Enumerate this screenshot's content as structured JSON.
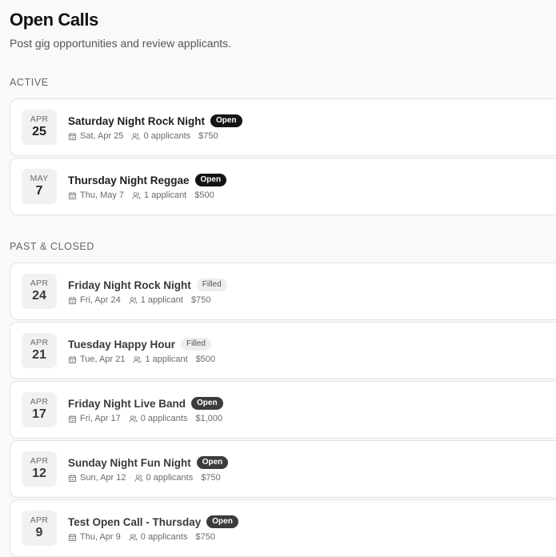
{
  "header": {
    "title": "Open Calls",
    "subtitle": "Post gig opportunities and review applicants."
  },
  "sections": {
    "active": {
      "heading": "ACTIVE",
      "items": [
        {
          "month": "APR",
          "day": "25",
          "title": "Saturday Night Rock Night",
          "status": "Open",
          "date": "Sat, Apr 25",
          "applicants": "0 applicants",
          "pay": "$750"
        },
        {
          "month": "MAY",
          "day": "7",
          "title": "Thursday Night Reggae",
          "status": "Open",
          "date": "Thu, May 7",
          "applicants": "1 applicant",
          "pay": "$500"
        }
      ]
    },
    "past": {
      "heading": "PAST & CLOSED",
      "items": [
        {
          "month": "APR",
          "day": "24",
          "title": "Friday Night Rock Night",
          "status": "Filled",
          "date": "Fri, Apr 24",
          "applicants": "1 applicant",
          "pay": "$750"
        },
        {
          "month": "APR",
          "day": "21",
          "title": "Tuesday Happy Hour",
          "status": "Filled",
          "date": "Tue, Apr 21",
          "applicants": "1 applicant",
          "pay": "$500"
        },
        {
          "month": "APR",
          "day": "17",
          "title": "Friday Night Live Band",
          "status": "Open",
          "date": "Fri, Apr 17",
          "applicants": "0 applicants",
          "pay": "$1,000"
        },
        {
          "month": "APR",
          "day": "12",
          "title": "Sunday Night Fun Night",
          "status": "Open",
          "date": "Sun, Apr 12",
          "applicants": "0 applicants",
          "pay": "$750"
        },
        {
          "month": "APR",
          "day": "9",
          "title": "Test Open Call - Thursday",
          "status": "Open",
          "date": "Thu, Apr 9",
          "applicants": "0 applicants",
          "pay": "$750"
        }
      ]
    }
  },
  "icons": {
    "date": "calendar-icon",
    "applicants": "users-icon"
  },
  "colors": {
    "badge_open": "#141414",
    "badge_open_past": "#3c3c3c",
    "badge_filled": "#eeeeee",
    "background": "#f9f9f9"
  }
}
